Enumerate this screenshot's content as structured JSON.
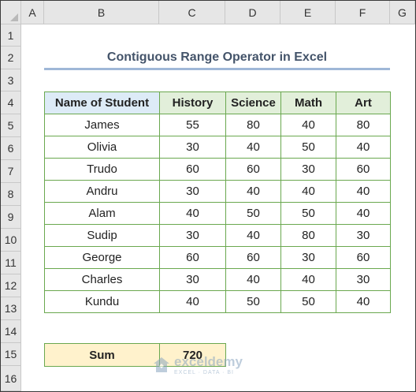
{
  "columns": [
    "A",
    "B",
    "C",
    "D",
    "E",
    "F",
    "G"
  ],
  "rows": [
    "1",
    "2",
    "3",
    "4",
    "5",
    "6",
    "7",
    "8",
    "9",
    "10",
    "11",
    "12",
    "13",
    "14",
    "15",
    "16"
  ],
  "title": "Contiguous Range Operator in Excel",
  "table": {
    "headers": [
      "Name of Student",
      "History",
      "Science",
      "Math",
      "Art"
    ],
    "rows": [
      [
        "James",
        "55",
        "80",
        "40",
        "80"
      ],
      [
        "Olivia",
        "30",
        "40",
        "50",
        "40"
      ],
      [
        "Trudo",
        "60",
        "60",
        "30",
        "60"
      ],
      [
        "Andru",
        "30",
        "40",
        "40",
        "40"
      ],
      [
        "Alam",
        "40",
        "50",
        "50",
        "40"
      ],
      [
        "Sudip",
        "30",
        "40",
        "80",
        "30"
      ],
      [
        "George",
        "60",
        "60",
        "30",
        "60"
      ],
      [
        "Charles",
        "30",
        "40",
        "40",
        "30"
      ],
      [
        "Kundu",
        "40",
        "50",
        "50",
        "40"
      ]
    ]
  },
  "sum": {
    "label": "Sum",
    "value": "720"
  },
  "watermark": {
    "name": "exceldemy",
    "tagline": "EXCEL · DATA · BI",
    "icon": "house-icon"
  },
  "colors": {
    "header_green": "#e2efda",
    "header_blue": "#ddebf7",
    "border_green": "#6aa84f",
    "sum_fill": "#fff2cc",
    "title_text": "#44546a"
  }
}
